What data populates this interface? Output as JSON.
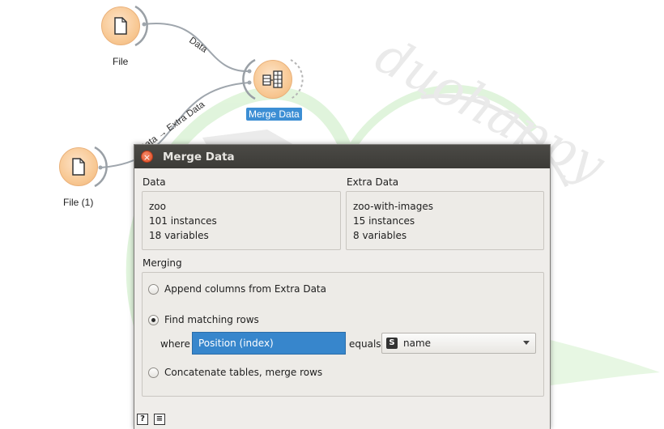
{
  "canvas": {
    "nodes": {
      "file": {
        "label": "File",
        "icon": "document-icon"
      },
      "file_1": {
        "label": "File (1)",
        "icon": "document-icon"
      },
      "merge": {
        "label": "Merge Data",
        "icon": "merge-table-icon"
      }
    },
    "links": {
      "data": "Data",
      "extra": "Data → Extra Data"
    },
    "watermark": "duohappy"
  },
  "dialog": {
    "title": "Merge Data",
    "data_section": {
      "title": "Data",
      "lines": [
        "zoo",
        "101 instances",
        "18 variables"
      ]
    },
    "extra_section": {
      "title": "Extra Data",
      "lines": [
        "zoo-with-images",
        "15 instances",
        "8 variables"
      ]
    },
    "merging": {
      "title": "Merging",
      "options": [
        {
          "label": "Append columns from Extra Data",
          "checked": false
        },
        {
          "label": "Find matching rows",
          "checked": true
        },
        {
          "label": "Concatenate tables, merge rows",
          "checked": false
        }
      ],
      "where_label": "where",
      "left_value": "Position (index)",
      "equals_label": "equals",
      "right_badge": "S",
      "right_value": "name"
    },
    "bottom_icons": [
      "help-icon",
      "report-icon"
    ],
    "bottom_glyphs": {
      "help": "?",
      "report": "≡"
    }
  },
  "colors": {
    "node_fill": "#f8c995",
    "selected_label": "#3c8ed4",
    "combo_highlight": "#3786cc",
    "titlebar": "#3c3b37",
    "arrow": "#e02020",
    "watermark_green": "#c8ecc0"
  }
}
